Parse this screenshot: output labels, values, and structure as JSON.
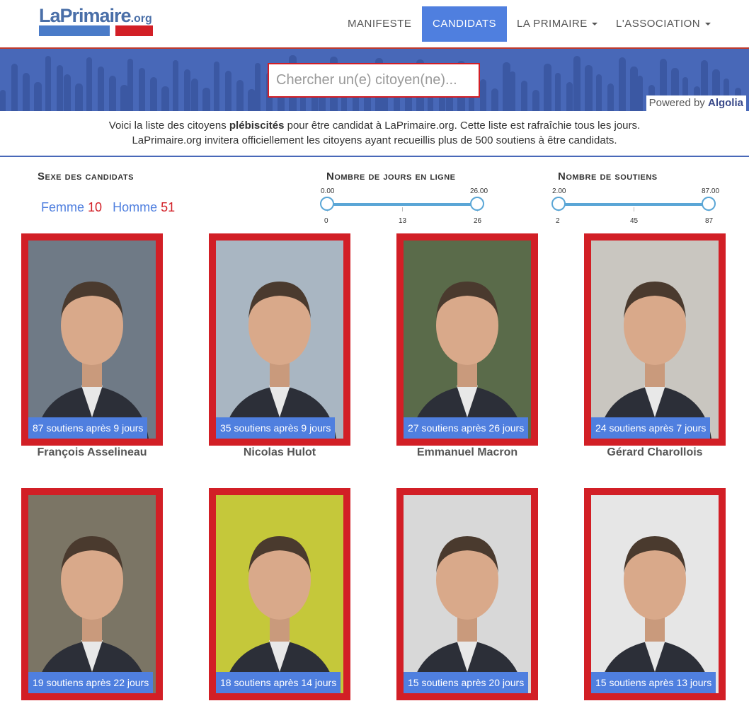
{
  "nav": {
    "logo_main": "LaPrimaire",
    "logo_tld": ".org",
    "items": [
      {
        "label": "MANIFESTE",
        "active": false,
        "dropdown": false
      },
      {
        "label": "CANDIDATS",
        "active": true,
        "dropdown": false
      },
      {
        "label": "LA PRIMAIRE",
        "active": false,
        "dropdown": true
      },
      {
        "label": "L'ASSOCIATION",
        "active": false,
        "dropdown": true
      }
    ]
  },
  "search": {
    "placeholder": "Chercher un(e) citoyen(ne)...",
    "powered_by": "Powered by",
    "powered_brand": "Algolia"
  },
  "intro": {
    "line1_a": "Voici la liste des citoyens ",
    "line1_bold": "plébiscités",
    "line1_b": " pour être candidat à LaPrimaire.org. Cette liste est rafraîchie tous les jours.",
    "line2": "LaPrimaire.org invitera officiellement les citoyens ayant recueillis plus de 500 soutiens à être candidats."
  },
  "filters": {
    "gender": {
      "title": "Sexe des candidats",
      "female_label": "Femme",
      "female_count": "10",
      "male_label": "Homme",
      "male_count": "51"
    },
    "days_online": {
      "title": "Nombre de jours en ligne",
      "min_value": "0.00",
      "max_value": "26.00",
      "ticks": [
        "0",
        "13",
        "26"
      ]
    },
    "supporters": {
      "title": "Nombre de soutiens",
      "min_value": "2.00",
      "max_value": "87.00",
      "ticks": [
        "2",
        "45",
        "87"
      ]
    }
  },
  "candidates": [
    {
      "name": "François Asselineau",
      "stats": "87 soutiens après 9 jours",
      "bg": "#6f7a86"
    },
    {
      "name": "Nicolas Hulot",
      "stats": "35 soutiens après 9 jours",
      "bg": "#a9b6c2"
    },
    {
      "name": "Emmanuel Macron",
      "stats": "27 soutiens après 26 jours",
      "bg": "#5a6b4a"
    },
    {
      "name": "Gérard Charollois",
      "stats": "24 soutiens après 7 jours",
      "bg": "#c9c6c0"
    },
    {
      "name": "",
      "stats": "19 soutiens après 22 jours",
      "bg": "#7b7565"
    },
    {
      "name": "",
      "stats": "18 soutiens après 14 jours",
      "bg": "#c5c83a"
    },
    {
      "name": "",
      "stats": "15 soutiens après 20 jours",
      "bg": "#d8d8d8"
    },
    {
      "name": "",
      "stats": "15 soutiens après 13 jours",
      "bg": "#e6e6e6"
    }
  ]
}
